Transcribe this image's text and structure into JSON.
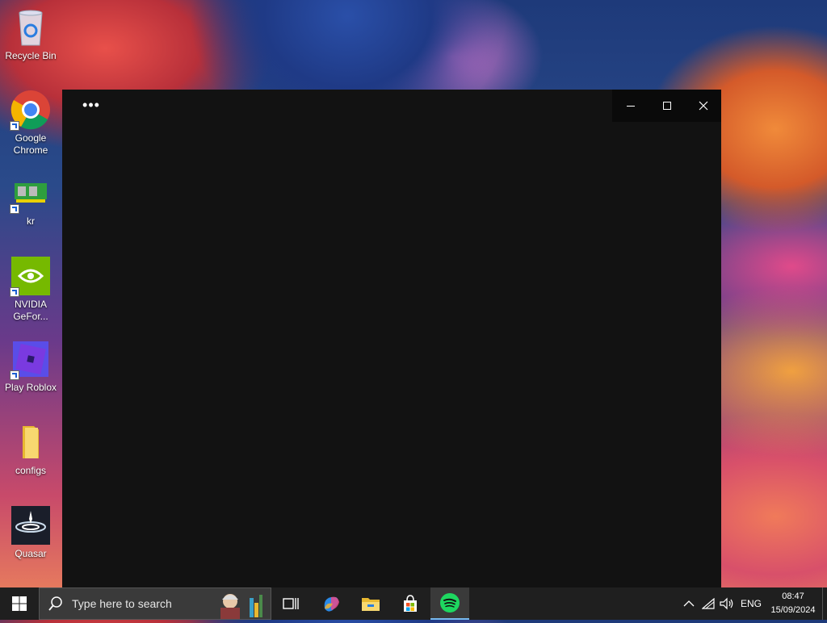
{
  "desktop": {
    "icons": [
      {
        "label": "Recycle Bin",
        "icon": "recycle-bin-icon"
      },
      {
        "label": "Google Chrome",
        "icon": "chrome-icon"
      },
      {
        "label": "kr",
        "icon": "memory-chip-icon"
      },
      {
        "label": "NVIDIA GeFor...",
        "icon": "nvidia-icon"
      },
      {
        "label": "Play Roblox",
        "icon": "roblox-icon"
      },
      {
        "label": "configs",
        "icon": "folder-icon"
      },
      {
        "label": "Quasar",
        "icon": "quasar-icon"
      }
    ]
  },
  "window": {
    "more_label": "•••",
    "background": "#121212"
  },
  "taskbar": {
    "search_placeholder": "Type here to search",
    "apps": [
      {
        "name": "task-view",
        "icon": "task-view-icon"
      },
      {
        "name": "copilot",
        "icon": "copilot-icon"
      },
      {
        "name": "file-explorer",
        "icon": "folder-icon"
      },
      {
        "name": "microsoft-store",
        "icon": "store-icon"
      },
      {
        "name": "spotify",
        "icon": "spotify-icon",
        "active": true
      }
    ],
    "tray": {
      "language": "ENG",
      "time": "08:47",
      "date": "15/09/2024"
    },
    "accent": "#1ed760"
  }
}
